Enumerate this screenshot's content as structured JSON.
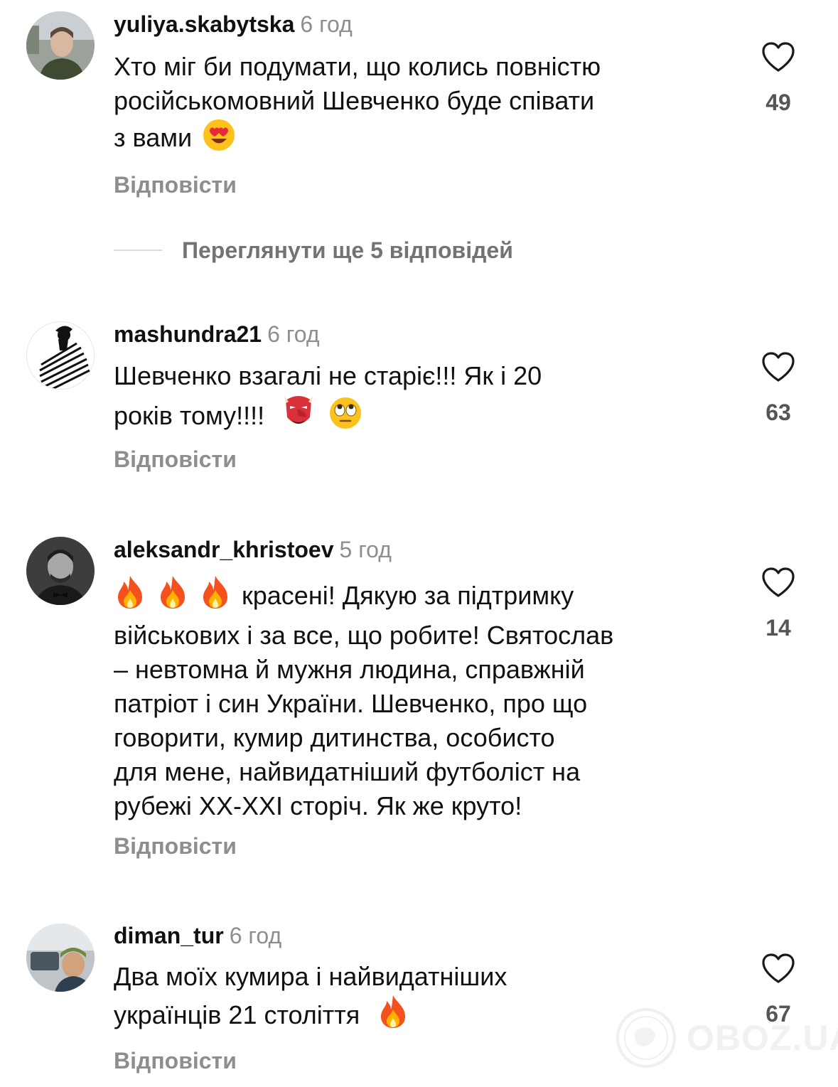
{
  "comments": [
    {
      "username": "yuliya.skabytska",
      "time": "6 год",
      "text_lines": [
        "Хто міг би подумати, що колись повністю",
        "російськомовний Шевченко буде співати",
        "з вами"
      ],
      "emojis": [
        "heart-eyes-emoji"
      ],
      "likes": "49",
      "reply_label": "Відповісти"
    },
    {
      "username": "mashundra21",
      "time": "6 год",
      "text_lines": [
        "Шевченко взагалі не старіє!!! Як і 20",
        "років тому!!!!"
      ],
      "emojis": [
        "goblin-mask-emoji",
        "eye-roll-emoji"
      ],
      "likes": "63",
      "reply_label": "Відповісти"
    },
    {
      "username": "aleksandr_khristoev",
      "time": "5 год",
      "text_lines": [
        " красені! Дякую за підтримку",
        "військових і за все, що робите! Святослав",
        "– невтомна й мужня людина, справжній",
        "патріот і син України. Шевченко, про що",
        "говорити, кумир дитинства, особисто",
        "для мене, найвидатніший футболіст на",
        "рубежі XX-XXI сторіч. Як же круто!"
      ],
      "emojis": [
        "fire-emoji",
        "fire-emoji",
        "fire-emoji"
      ],
      "likes": "14",
      "reply_label": "Відповісти"
    },
    {
      "username": "diman_tur",
      "time": "6 год",
      "text_lines": [
        "Два моїх кумира і найвидатніших",
        "українців 21 століття"
      ],
      "emojis": [
        "fire-emoji"
      ],
      "likes": "67",
      "reply_label": "Відповісти"
    }
  ],
  "view_more_replies": "Переглянути ще 5 відповідей",
  "watermark": "OBOZ.UA",
  "icons": {
    "like": "heart-outline-icon"
  },
  "colors": {
    "text": "#111111",
    "secondary": "#8e8e8e",
    "like_count": "#555555"
  }
}
